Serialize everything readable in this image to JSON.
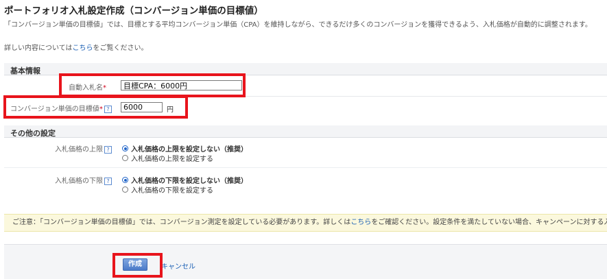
{
  "page": {
    "title": "ポートフォリオ入札設定作成（コンバージョン単価の目標値）",
    "description": "「コンバージョン単価の目標値」では、目標とする平均コンバージョン単価（CPA）を維持しながら、できるだけ多くのコンバージョンを獲得できるよう、入札価格が自動的に調整されます。",
    "details_prefix": "詳しい内容については",
    "details_link": "こちら",
    "details_suffix": "をご覧ください。"
  },
  "basic_info": {
    "heading": "基本情報",
    "auto_bid_name_label": "自動入札名",
    "auto_bid_name_value": "目標CPA：6000円",
    "target_cpa_label": "コンバージョン単価の目標値",
    "target_cpa_value": "6000",
    "target_cpa_unit": "円",
    "required_mark": "*",
    "help_icon_text": "?"
  },
  "other_settings": {
    "heading": "その他の設定",
    "upper_limit": {
      "label": "入札価格の上限",
      "options": [
        {
          "label": "入札価格の上限を設定しない（推奨）",
          "selected": true
        },
        {
          "label": "入札価格の上限を設定する",
          "selected": false
        }
      ]
    },
    "lower_limit": {
      "label": "入札価格の下限",
      "options": [
        {
          "label": "入札価格の下限を設定しない（推奨）",
          "selected": true
        },
        {
          "label": "入札価格の下限を設定する",
          "selected": false
        }
      ]
    }
  },
  "notice": {
    "prefix": "ご注意：「コンバージョン単価の目標値」では、コンバージョン測定を設定している必要があります。詳しくは",
    "link": "こちら",
    "suffix": "をご確認ください。設定条件を満たしていない場合、キャンペーンに対する入"
  },
  "footer": {
    "create_label": "作成",
    "cancel_label": "キャンセル"
  },
  "colors": {
    "highlight": "#e8141c",
    "link": "#1a5fb4",
    "notice_bg": "#fbf8dd",
    "primary_button": "#4b7ac8"
  }
}
